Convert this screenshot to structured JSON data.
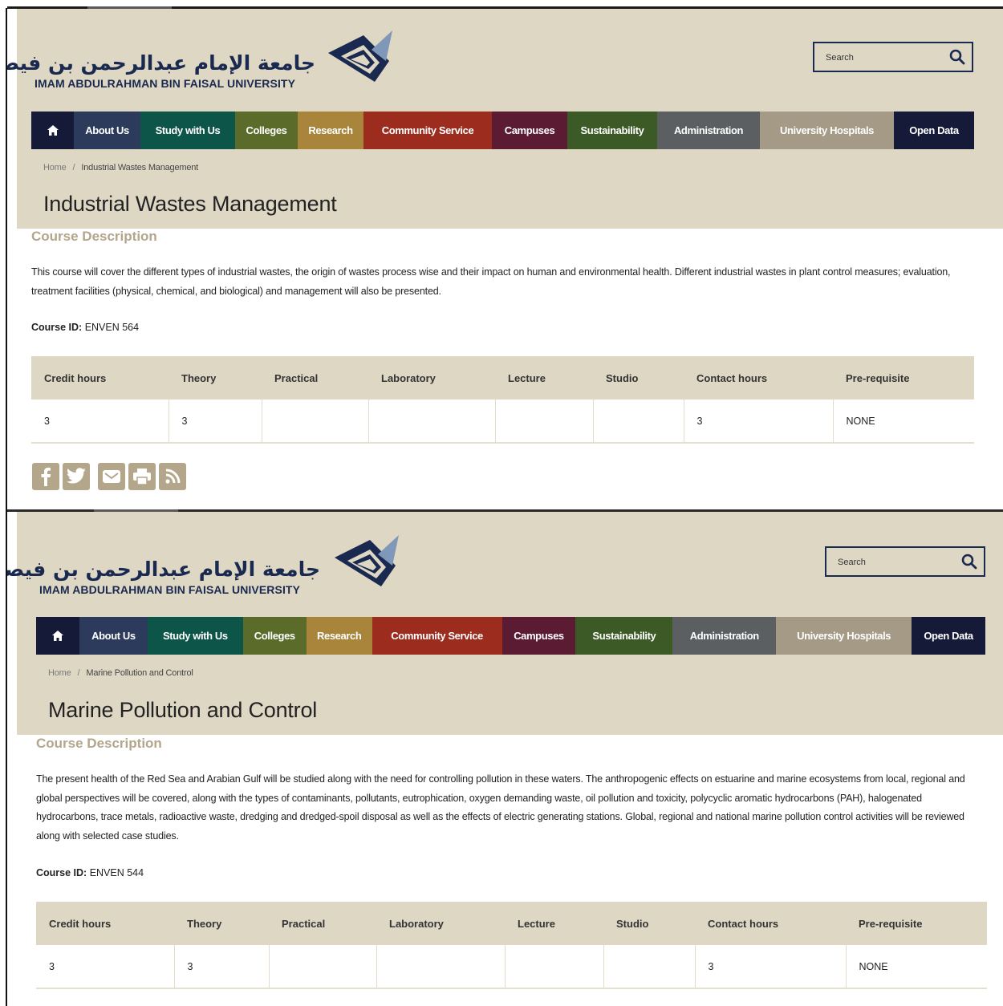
{
  "university": {
    "name_ar": "جامعة الإمام عبدالرحمن بن فيصل",
    "name_en": "IMAM ABDULRAHMAN BIN FAISAL UNIVERSITY"
  },
  "search": {
    "placeholder": "Search",
    "icon": "search-icon"
  },
  "nav": {
    "items": [
      {
        "label": "About Us",
        "color": "#2c3a5c"
      },
      {
        "label": "Study with Us",
        "color": "#0e5549"
      },
      {
        "label": "Colleges",
        "color": "#5a6b2a"
      },
      {
        "label": "Research",
        "color": "#a8853a"
      },
      {
        "label": "Community Service",
        "color": "#9b2c1e"
      },
      {
        "label": "Campuses",
        "color": "#5a1b33"
      },
      {
        "label": "Sustainability",
        "color": "#3c5a26"
      },
      {
        "label": "Administration",
        "color": "#5b5f61"
      },
      {
        "label": "University Hospitals",
        "color": "#a49a86"
      },
      {
        "label": "Open Data",
        "color": "#151a38"
      }
    ],
    "home_icon": "home-icon"
  },
  "table_headers": [
    "Credit hours",
    "Theory",
    "Practical",
    "Laboratory",
    "Lecture",
    "Studio",
    "Contact hours",
    "Pre-requisite"
  ],
  "pages": [
    {
      "breadcrumb": {
        "home": "Home",
        "sep": "/",
        "current": "Industrial Wastes Management"
      },
      "title": "Industrial Wastes Management",
      "section_heading": "Course Description",
      "description": "This course will cover the different types of industrial wastes, the origin of wastes process wise and their impact on human and environmental health.  Different industrial wastes in plant control measures; evaluation, treatment facilities (physical, chemical, and biological) and management will also be presented.",
      "course_id_label": "Course ID:",
      "course_id": "ENVEN 564",
      "row": [
        "3",
        "3",
        "",
        "",
        "",
        "",
        "3",
        "NONE"
      ],
      "social": [
        "facebook-icon",
        "twitter-icon",
        "email-icon",
        "print-icon",
        "rss-icon"
      ]
    },
    {
      "breadcrumb": {
        "home": "Home",
        "sep": "/",
        "current": "Marine Pollution and Control"
      },
      "title": "Marine Pollution and Control",
      "section_heading": "Course Description",
      "description": "The present health of the Red Sea and Arabian Gulf will be studied along with the need for controlling pollution in these waters.  The anthropogenic effects on estuarine and marine ecosystems from local, regional and global perspectives will be covered, along with the types of contaminants, pollutants, eutrophication, oxygen demanding waste, oil pollution and toxicity, polycyclic aromatic hydrocarbons (PAH), halogenated hydrocarbons, trace metals, radioactive waste, dredging and dredged-spoil disposal as well as the effects of electric generating stations. Global, regional and national marine pollution control activities will be reviewed along with selected case studies.",
      "course_id_label": "Course ID:",
      "course_id": "ENVEN 544",
      "row": [
        "3",
        "3",
        "",
        "",
        "",
        "",
        "3",
        "NONE"
      ]
    }
  ]
}
